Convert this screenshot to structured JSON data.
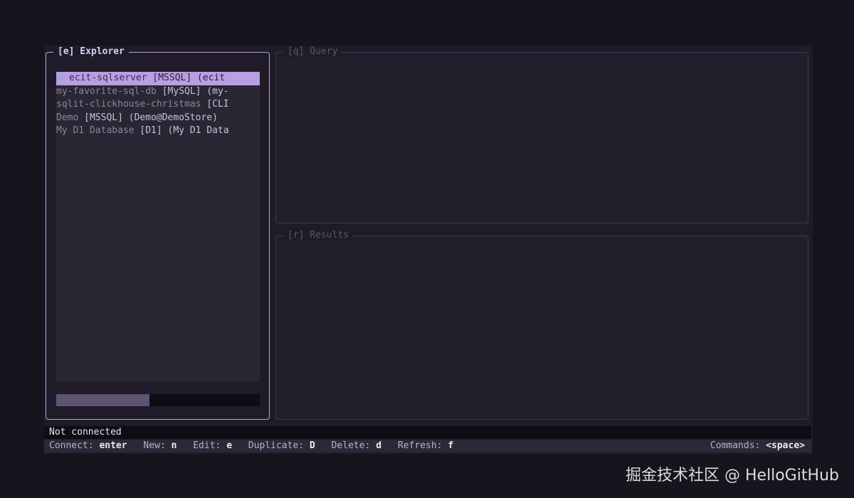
{
  "explorer": {
    "title": "[e] Explorer",
    "icon": "database-icon",
    "connections": [
      {
        "name": "ecit-sqlserver",
        "tag": "[MSSQL]",
        "detail": "(ecit"
      },
      {
        "name": "my-favorite-sql-db",
        "tag": "[MySQL]",
        "detail": "(my-"
      },
      {
        "name": "sqlit-clickhouse-christmas",
        "tag": "[CLI",
        "detail": ""
      },
      {
        "name": "Demo",
        "tag": "[MSSQL]",
        "detail": "(Demo@DemoStore)"
      },
      {
        "name": "My D1 Database",
        "tag": "[D1]",
        "detail": "(My D1 Data"
      }
    ],
    "selected_index": 0
  },
  "query": {
    "title": "[q] Query"
  },
  "results": {
    "title": "[r] Results"
  },
  "status": {
    "text": "Not connected"
  },
  "keybar": {
    "items": [
      {
        "label": "Connect:",
        "key": "enter"
      },
      {
        "label": "New:",
        "key": "n"
      },
      {
        "label": "Edit:",
        "key": "e"
      },
      {
        "label": "Duplicate:",
        "key": "D"
      },
      {
        "label": "Delete:",
        "key": "d"
      },
      {
        "label": "Refresh:",
        "key": "f"
      }
    ],
    "commands": {
      "label": "Commands:",
      "key": "<space>"
    }
  },
  "watermark": "掘金技术社区 @ HelloGitHub",
  "colors": {
    "accent": "#b99fe0",
    "active_border": "#b6a6dc",
    "background": "#16141c"
  }
}
